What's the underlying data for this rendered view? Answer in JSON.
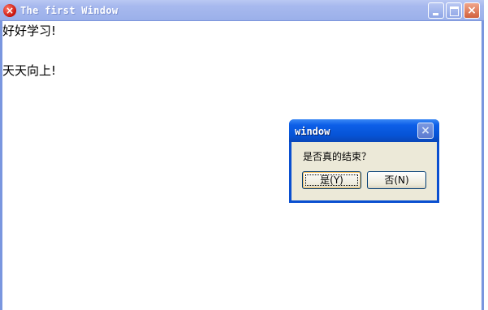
{
  "window": {
    "title": "The first Window",
    "close_glyph": "×",
    "icon": "error-close-icon"
  },
  "content": {
    "line1": "好好学习!",
    "line2": "天天向上!"
  },
  "dialog": {
    "title": "window",
    "message": "是否真的结束？",
    "yes_label": "是(Y)",
    "no_label": "否(N)",
    "close_glyph": "×"
  },
  "colors": {
    "titlebar": "#a7b9ee",
    "dialog_titlebar": "#0653d6",
    "dialog_body": "#ece9d8"
  }
}
